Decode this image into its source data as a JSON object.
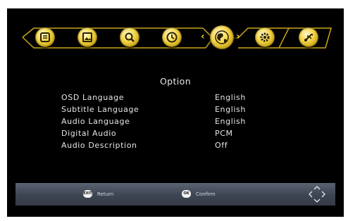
{
  "menu": {
    "items": [
      {
        "name": "program-icon"
      },
      {
        "name": "picture-icon"
      },
      {
        "name": "search-icon"
      },
      {
        "name": "time-icon"
      },
      {
        "name": "option-icon",
        "selected": true
      },
      {
        "name": "system-icon"
      },
      {
        "name": "usb-icon"
      }
    ],
    "accent_color": "#e8c52a"
  },
  "page_title": "Option",
  "settings": [
    {
      "label": "OSD Language",
      "value": "English"
    },
    {
      "label": "Subtitle Language",
      "value": "English"
    },
    {
      "label": "Audio Language",
      "value": "English"
    },
    {
      "label": "Digital Audio",
      "value": "PCM"
    },
    {
      "label": "Audio Description",
      "value": "Off"
    }
  ],
  "help_bar": {
    "return_key": "EXIT",
    "return_label": "Return",
    "confirm_key": "OK",
    "confirm_label": "Confirm"
  }
}
